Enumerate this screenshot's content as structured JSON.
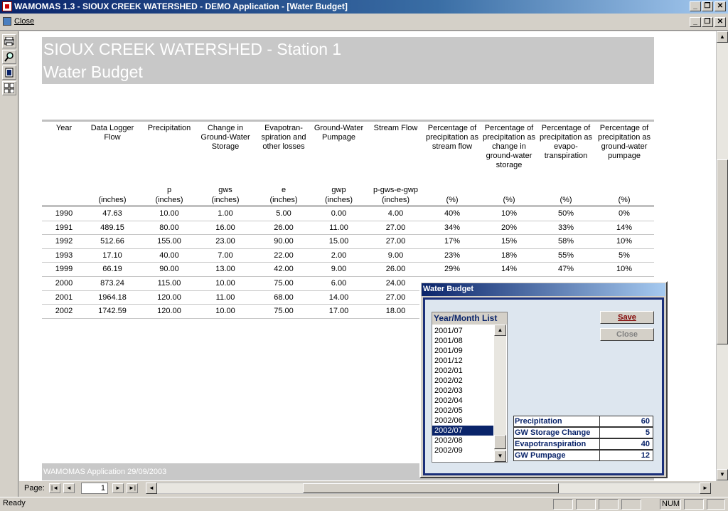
{
  "window": {
    "title": "WAMOMAS 1.3 - SIOUX CREEK WATERSHED - DEMO Application - [Water Budget]",
    "min": "_",
    "restore": "❐",
    "close": "✕"
  },
  "menu": {
    "close_label": "Close"
  },
  "toolbar": {
    "print_icon": "printer-icon",
    "zoom_icon": "magnifier-icon",
    "one_page_icon": "one-page-icon",
    "multi_page_icon": "multi-page-icon"
  },
  "report": {
    "title": "SIOUX CREEK WATERSHED - Station 1",
    "subtitle": "Water Budget",
    "columns": [
      {
        "header": "Year",
        "symbol": "",
        "unit": ""
      },
      {
        "header": "Data Logger Flow",
        "symbol": "",
        "unit": "(inches)"
      },
      {
        "header": "Precipitation",
        "symbol": "p",
        "unit": "(inches)"
      },
      {
        "header": "Change in Ground-Water Storage",
        "symbol": "gws",
        "unit": "(inches)"
      },
      {
        "header": "Evapotran- spiration and other losses",
        "symbol": "e",
        "unit": "(inches)"
      },
      {
        "header": "Ground-Water Pumpage",
        "symbol": "gwp",
        "unit": "(inches)"
      },
      {
        "header": "Stream Flow",
        "symbol": "p-gws-e-gwp",
        "unit": "(inches)"
      },
      {
        "header": "Percentage of precipitation as stream flow",
        "symbol": "",
        "unit": "(%)"
      },
      {
        "header": "Percentage of precipitation as change in ground-water storage",
        "symbol": "",
        "unit": "(%)"
      },
      {
        "header": "Percentage of precipitation as evapo- transpiration",
        "symbol": "",
        "unit": "(%)"
      },
      {
        "header": "Percentage of precipitation as ground-water pumpage",
        "symbol": "",
        "unit": "(%)"
      }
    ],
    "rows": [
      [
        "1990",
        "47.63",
        "10.00",
        "1.00",
        "5.00",
        "0.00",
        "4.00",
        "40%",
        "10%",
        "50%",
        "0%"
      ],
      [
        "1991",
        "489.15",
        "80.00",
        "16.00",
        "26.00",
        "11.00",
        "27.00",
        "34%",
        "20%",
        "33%",
        "14%"
      ],
      [
        "1992",
        "512.66",
        "155.00",
        "23.00",
        "90.00",
        "15.00",
        "27.00",
        "17%",
        "15%",
        "58%",
        "10%"
      ],
      [
        "1993",
        "17.10",
        "40.00",
        "7.00",
        "22.00",
        "2.00",
        "9.00",
        "23%",
        "18%",
        "55%",
        "5%"
      ],
      [
        "1999",
        "66.19",
        "90.00",
        "13.00",
        "42.00",
        "9.00",
        "26.00",
        "29%",
        "14%",
        "47%",
        "10%"
      ],
      [
        "2000",
        "873.24",
        "115.00",
        "10.00",
        "75.00",
        "6.00",
        "24.00",
        "",
        "",
        "",
        ""
      ],
      [
        "2001",
        "1964.18",
        "120.00",
        "11.00",
        "68.00",
        "14.00",
        "27.00",
        "",
        "",
        "",
        ""
      ],
      [
        "2002",
        "1742.59",
        "120.00",
        "10.00",
        "75.00",
        "17.00",
        "18.00",
        "",
        "",
        "",
        ""
      ]
    ],
    "footer": "WAMOMAS Application    29/09/2003"
  },
  "nav": {
    "page_label": "Page:",
    "page_value": "1",
    "first": "|◄",
    "prev": "◄",
    "next": "►",
    "last": "►|"
  },
  "status": {
    "text": "Ready",
    "num": "NUM"
  },
  "dialog": {
    "title": "Water Budget",
    "list_header": "Year/Month List",
    "list_items": [
      "2001/07",
      "2001/08",
      "2001/09",
      "2001/12",
      "2002/01",
      "2002/02",
      "2002/03",
      "2002/04",
      "2002/05",
      "2002/06",
      "2002/07",
      "2002/08",
      "2002/09"
    ],
    "selected_item": "2002/07",
    "save_label": "Save",
    "close_label": "Close",
    "fields": [
      {
        "label": "Precipitation",
        "value": "60"
      },
      {
        "label": "GW Storage Change",
        "value": "5"
      },
      {
        "label": "Evapotranspiration",
        "value": "40"
      },
      {
        "label": "GW Pumpage",
        "value": "12"
      }
    ]
  }
}
